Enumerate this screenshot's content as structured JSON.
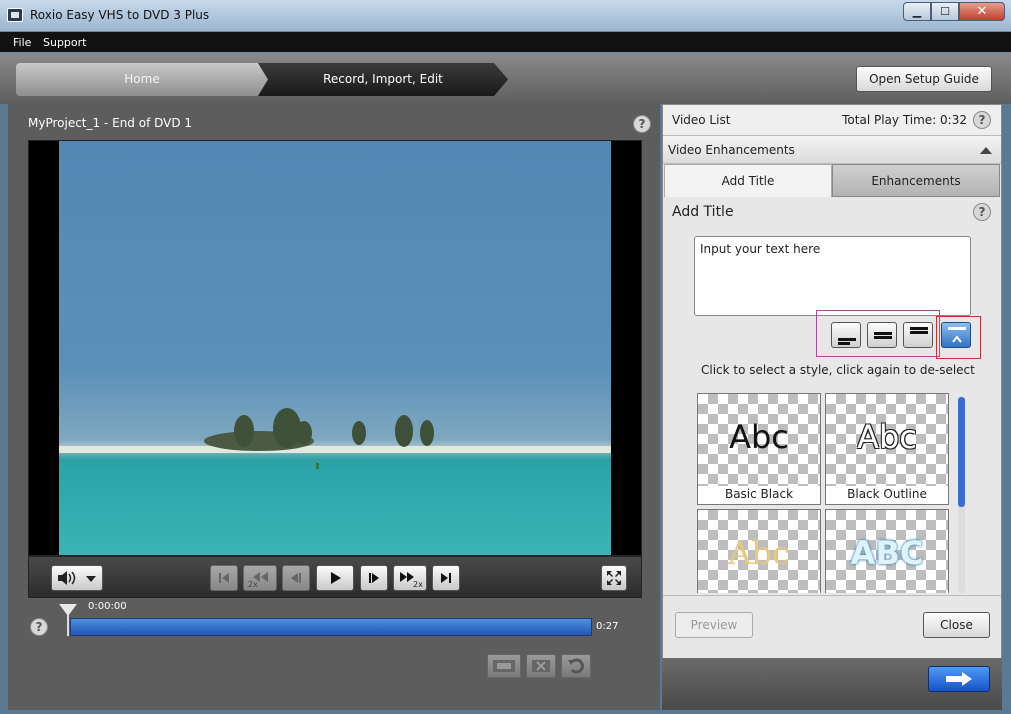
{
  "window": {
    "title": "Roxio Easy VHS to DVD 3 Plus",
    "close_glyph": "✕",
    "minimize_glyph": "▁",
    "maximize_glyph": "☐"
  },
  "menu": {
    "items": [
      "File",
      "Support"
    ]
  },
  "nav": {
    "crumbs": [
      "Home",
      "Record, Import, Edit"
    ],
    "setup_button": "Open Setup Guide"
  },
  "player": {
    "project_title": "MyProject_1 - End of DVD 1",
    "help_glyph": "?",
    "speed_badge": "2x",
    "time_start": "0:00:00",
    "time_end": "0:27",
    "progress": 0.0
  },
  "panel": {
    "video_list_label": "Video List",
    "total_play_time": "Total Play Time: 0:32",
    "section_header": "Video Enhancements",
    "tabs": [
      {
        "label": "Add Title",
        "active": true
      },
      {
        "label": "Enhancements",
        "active": false
      }
    ],
    "add_title_heading": "Add Title",
    "text_value": "Input your text here",
    "style_hint": "Click to select a style, click again to de-select",
    "styles": [
      {
        "label": "Basic Black",
        "sample": "Abc",
        "color": "#111111"
      },
      {
        "label": "Black Outline",
        "sample": "Abc",
        "color": "#ffffff"
      },
      {
        "label": "",
        "sample": "Abc",
        "color": "#e8c97a"
      },
      {
        "label": "",
        "sample": "ABC",
        "color": "#dff3ff"
      }
    ],
    "preview_button": "Preview",
    "close_button": "Close"
  },
  "colors": {
    "accent": "#2f72c4",
    "timeline": "#2c6bd0",
    "highlight_purple": "#a54aa5",
    "highlight_red": "#d03030"
  }
}
